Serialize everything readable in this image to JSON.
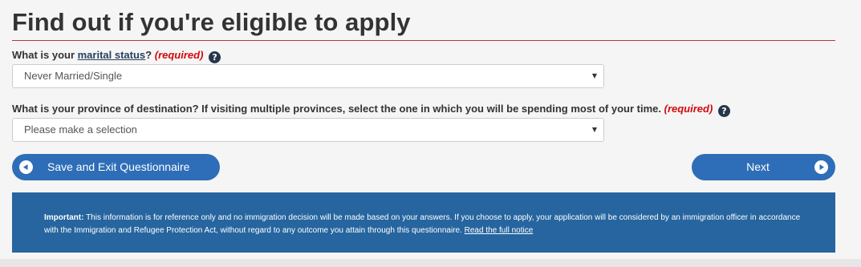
{
  "page": {
    "title": "Find out if you're eligible to apply"
  },
  "questions": {
    "marital": {
      "prefix": "What is your ",
      "term_link": "marital status",
      "suffix": "?",
      "required": "(required)",
      "help_icon": "question-circle-icon",
      "selected": "Never Married/Single"
    },
    "province": {
      "label": "What is your province of destination? If visiting multiple provinces, select the one in which you will be spending most of your time.",
      "required": "(required)",
      "help_icon": "question-circle-icon",
      "selected": "Please make a selection"
    },
    "help_glyph": "?"
  },
  "buttons": {
    "save_exit": "Save and Exit Questionnaire",
    "next": "Next"
  },
  "notice": {
    "important_label": "Important:",
    "body": "This information is for reference only and no immigration decision will be made based on your answers. If you choose to apply, your application will be considered by an immigration officer in accordance with the Immigration and Refugee Protection Act, without regard to any outcome you attain through this questionnaire.",
    "link": "Read the full notice"
  },
  "colors": {
    "accent_button": "#2e6db7",
    "notice_bg": "#26659f",
    "rule": "#af3c43",
    "required": "#d3080c"
  }
}
